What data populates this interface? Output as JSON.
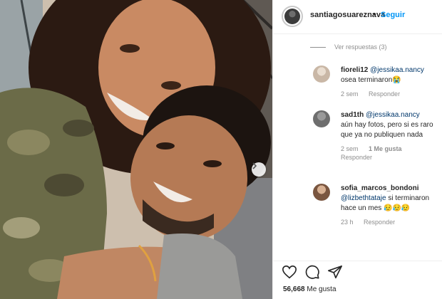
{
  "post": {
    "username": "santiagosuareznava",
    "separator": "•",
    "follow_label": "Seguir",
    "view_replies_label": "Ver respuestas (3)",
    "likes_count": "56,668",
    "likes_suffix": "Me gusta"
  },
  "comments": [
    {
      "user": "fioreli12",
      "mention": "@jessikaa.nancy",
      "text": "osea terminaron😭",
      "time": "2 sem",
      "likes": "",
      "reply": "Responder",
      "avatar_color": "#c9b7a6"
    },
    {
      "user": "sad1th",
      "mention": "@jessikaa.nancy",
      "text": "aún hay fotos, pero si es raro que ya no publiquen nada",
      "time": "2 sem",
      "likes": "1 Me gusta",
      "reply": "Responder",
      "avatar_color": "#7a7a7a"
    },
    {
      "user": "sofia_marcos_bondoni",
      "mention": "@lizbethtataje",
      "text": "si terminaron hace un mes 😥😥😥",
      "time": "23 h",
      "likes": "",
      "reply": "Responder",
      "avatar_color": "#b08a6b"
    }
  ],
  "icons": {
    "like": "heart-icon",
    "comment": "comment-icon",
    "share": "paper-plane-icon",
    "carousel": "chevron-right-icon"
  },
  "colors": {
    "accent": "#0095f6",
    "mention": "#00376b",
    "muted": "#8e8e8e"
  }
}
